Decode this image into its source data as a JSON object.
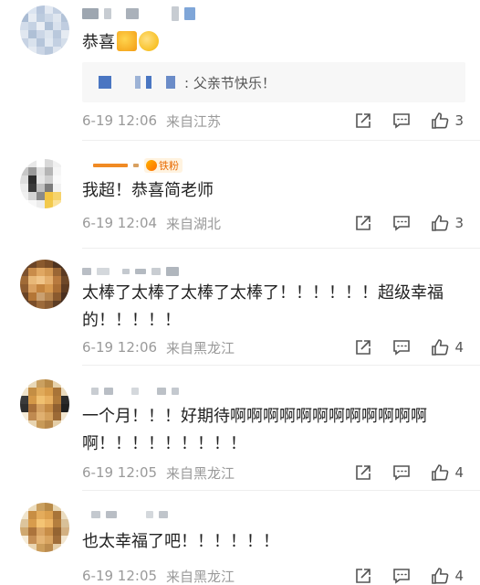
{
  "comments": [
    {
      "text": "恭喜",
      "quote": {
        "reply": ": 父亲节快乐！"
      },
      "time": "6-19 12:06",
      "location": "来自江苏",
      "likes": "3"
    },
    {
      "badge": "铁粉",
      "text": "我超！恭喜简老师",
      "time": "6-19 12:04",
      "location": "来自湖北",
      "likes": "3"
    },
    {
      "text": "太棒了太棒了太棒了太棒了！！！！！！超级幸福的！！！！！",
      "time": "6-19 12:06",
      "location": "来自黑龙江",
      "likes": "4"
    },
    {
      "text": "一个月！！！好期待啊啊啊啊啊啊啊啊啊啊啊啊啊！！！！！！！！！",
      "time": "6-19 12:05",
      "location": "来自黑龙江",
      "likes": "4"
    },
    {
      "text": "也太幸福了吧！！！！！！",
      "time": "6-19 12:05",
      "location": "来自黑龙江",
      "likes": "4"
    }
  ],
  "icons": {
    "share": "share-icon",
    "reply": "comment-icon",
    "like": "thumbs-up-icon"
  },
  "colors": {
    "meta_text": "#9a9a9a",
    "badge_text": "#e86a00",
    "quote_name": "#3b6fb6"
  }
}
